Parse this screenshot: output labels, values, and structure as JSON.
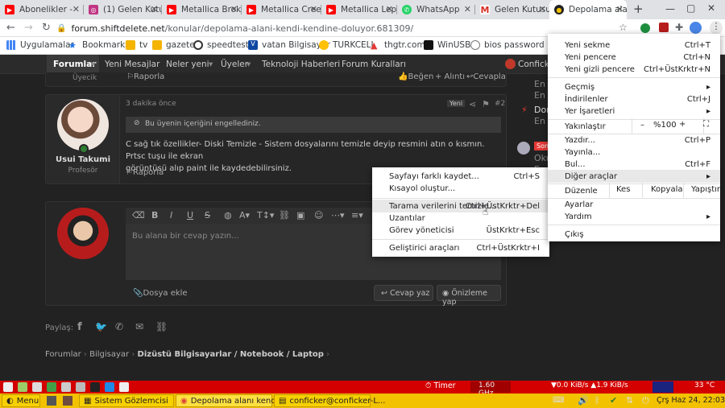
{
  "tabs": [
    {
      "title": "Abonelikler -",
      "favicon": "youtube-icon"
    },
    {
      "title": "(1) Gelen Kutu",
      "favicon": "instagram-icon"
    },
    {
      "title": "Metallica Brok",
      "favicon": "youtube-icon"
    },
    {
      "title": "Metallica Cree",
      "favicon": "youtube-icon"
    },
    {
      "title": "Metallica Lepe",
      "favicon": "youtube-icon"
    },
    {
      "title": "WhatsApp",
      "favicon": "whatsapp-icon"
    },
    {
      "title": "Gelen Kutusu",
      "favicon": "gmail-icon"
    },
    {
      "title": "Depolama ala",
      "favicon": "shiftdelete-icon"
    }
  ],
  "new_tab": "+",
  "url": {
    "host": "forum.shiftdelete.net",
    "path": "/konular/depolama-alani-kendi-kendine-doluyor.681309/"
  },
  "bookmarks": [
    "Uygulamalar",
    "Bookmarks",
    "tv",
    "gazete",
    "speedtest",
    "vatan Bilgisayar",
    "TURKCELL",
    "thgtr.com",
    "WinUSB",
    "bios password"
  ],
  "site_nav": {
    "items": [
      "Forumlar",
      "Yeni Mesajlar",
      "Neler yeni",
      "Üyeler",
      "Teknoloji Haberleri",
      "Forum Kuralları"
    ],
    "user": "Conficker"
  },
  "prev_post": {
    "user_title": "Üyecik",
    "report": "Raporla",
    "like": "Beğen",
    "quote": "+ Alıntı",
    "reply": "Cevapla"
  },
  "post": {
    "time": "3 dakika önce",
    "badge": "Yeni",
    "number": "#2",
    "blocked": "Bu üyenin içeriğini engellediniz.",
    "text_line1": "C sağ tık özellikler- Diski Temizle - Sistem dosyalarını temizle deyip resmini atın o kısmın. Prtsc tuşu ile ekran",
    "text_line2": "görüntüsü alıp paint ile kaydedebilirsiniz.",
    "author": "Usui Takumi",
    "author_title": "Profesör",
    "report": "Raporla"
  },
  "reply": {
    "placeholder": "Bu alana bir cevap yazın...",
    "attach": "Dosya ekle",
    "submit": "Cevap yaz",
    "preview": "Önizleme yap"
  },
  "share": {
    "label": "Paylaş:"
  },
  "breadcrumb": [
    "Forumlar",
    "Bilgisayar",
    "Dizüstü Bilgisayarlar / Notebook / Laptop"
  ],
  "right_sidebar": [
    "En",
    "En",
    "Don",
    "En",
    "Son",
    "Oku",
    "En"
  ],
  "page_menu": [
    {
      "label": "Sayfayı farklı kaydet...",
      "shortcut": "Ctrl+S"
    },
    {
      "label": "Kısayol oluştur...",
      "shortcut": ""
    },
    {
      "label": "Tarama verilerini temizle...",
      "shortcut": "Ctrl+ÜstKrktr+Del"
    },
    {
      "label": "Uzantılar",
      "shortcut": ""
    },
    {
      "label": "Görev yöneticisi",
      "shortcut": "ÜstKrktr+Esc"
    },
    {
      "label": "Geliştirici araçları",
      "shortcut": "Ctrl+ÜstKrktr+I"
    }
  ],
  "chrome_menu": {
    "new_tab": {
      "label": "Yeni sekme",
      "shortcut": "Ctrl+T"
    },
    "new_window": {
      "label": "Yeni pencere",
      "shortcut": "Ctrl+N"
    },
    "incognito": {
      "label": "Yeni gizli pencere",
      "shortcut": "Ctrl+ÜstKrktr+N"
    },
    "history": {
      "label": "Geçmiş"
    },
    "downloads": {
      "label": "İndirilenler",
      "shortcut": "Ctrl+J"
    },
    "bookmarks": {
      "label": "Yer İşaretleri"
    },
    "zoom": {
      "label": "Yakınlaştır",
      "minus": "–",
      "value": "%100",
      "plus": "+"
    },
    "print": {
      "label": "Yazdır...",
      "shortcut": "Ctrl+P"
    },
    "cast": {
      "label": "Yayınla..."
    },
    "find": {
      "label": "Bul...",
      "shortcut": "Ctrl+F"
    },
    "more_tools": {
      "label": "Diğer araçlar"
    },
    "edit": {
      "label": "Düzenle",
      "cut": "Kes",
      "copy": "Kopyala",
      "paste": "Yapıştır"
    },
    "settings": {
      "label": "Ayarlar"
    },
    "help": {
      "label": "Yardım"
    },
    "exit": {
      "label": "Çıkış"
    }
  },
  "system_panel": {
    "timer": "Timer",
    "cpu": "1.60 GHz",
    "net": "0.0 KiB/s",
    "net2": "1.9 KiB/s",
    "temp": "33 °C"
  },
  "taskbar": {
    "menu": "Menu",
    "items": [
      "Sistem Gözlemcisi",
      "Depolama alanı kendi ...",
      "conficker@conficker-L..."
    ],
    "clock": "Çrş Haz 24, 22:03:39"
  }
}
